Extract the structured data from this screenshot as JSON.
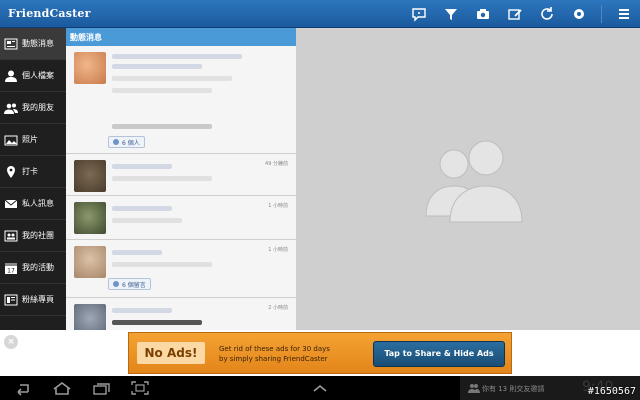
{
  "app": {
    "title": "FriendCaster"
  },
  "toolbar": {
    "actions": [
      {
        "name": "chat-icon"
      },
      {
        "name": "filter-icon"
      },
      {
        "name": "camera-icon"
      },
      {
        "name": "compose-icon"
      },
      {
        "name": "refresh-icon"
      },
      {
        "name": "settings-icon"
      },
      {
        "name": "menu-icon"
      }
    ]
  },
  "nav": {
    "items": [
      {
        "label": "動態消息",
        "icon": "news-icon",
        "active": true
      },
      {
        "label": "個人檔案",
        "icon": "person-icon"
      },
      {
        "label": "我的朋友",
        "icon": "friends-icon"
      },
      {
        "label": "照片",
        "icon": "photos-icon"
      },
      {
        "label": "打卡",
        "icon": "location-pin-icon"
      },
      {
        "label": "私人訊息",
        "icon": "mail-icon"
      },
      {
        "label": "我的社團",
        "icon": "groups-icon"
      },
      {
        "label": "我的活動",
        "icon": "calendar-icon",
        "calendar_day": "17"
      },
      {
        "label": "粉絲專頁",
        "icon": "pages-icon"
      }
    ]
  },
  "feed": {
    "header": "動態消息",
    "posts": [
      {
        "time": "",
        "chip": "6 個人"
      },
      {
        "time": "49 分鐘前",
        "chip": ""
      },
      {
        "time": "1 小時前",
        "chip": ""
      },
      {
        "time": "1 小時前",
        "chip": "6 個留言"
      },
      {
        "time": "2 小時前",
        "chip": ""
      }
    ]
  },
  "ad": {
    "title": "No Ads!",
    "line1": "Get rid of these ads for 30 days",
    "line2": "by simply sharing FriendCaster",
    "button": "Tap to Share & Hide Ads",
    "close": "×"
  },
  "system": {
    "notification": "你有 13 則交友邀請",
    "clock": "9:40",
    "watermark": "#1650567"
  },
  "colors": {
    "topbar": "#1f65ad",
    "accent": "#4a9ad8",
    "ad": "#eb9326",
    "ad_button": "#1f5a87"
  }
}
